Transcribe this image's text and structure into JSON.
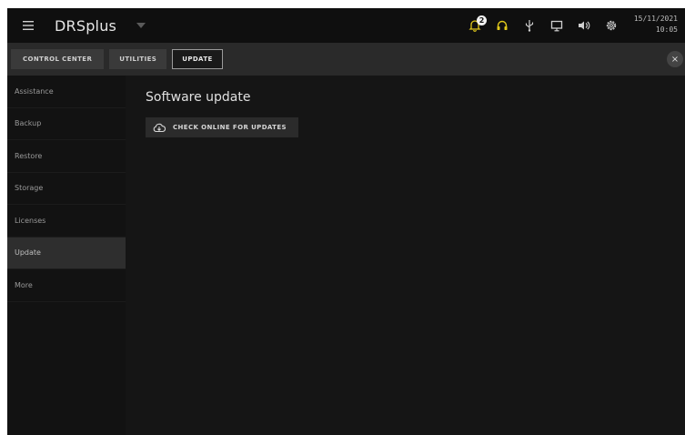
{
  "app": {
    "title": "DRSplus"
  },
  "status": {
    "notification_count": "2",
    "date": "15/11/2021",
    "time": "10:05",
    "colors": {
      "headset_accent": "#e0c81a"
    }
  },
  "icons": [
    "menu-icon",
    "caret-down-icon",
    "bell-icon",
    "headset-icon",
    "usb-icon",
    "monitor-icon",
    "volume-icon",
    "gear-icon",
    "cloud-download-icon",
    "close-icon"
  ],
  "tabs": [
    {
      "label": "CONTROL CENTER"
    },
    {
      "label": "UTILITIES"
    },
    {
      "label": "UPDATE"
    }
  ],
  "close_label": "×",
  "sidebar": {
    "items": [
      {
        "label": "Assistance"
      },
      {
        "label": "Backup"
      },
      {
        "label": "Restore"
      },
      {
        "label": "Storage"
      },
      {
        "label": "Licenses"
      },
      {
        "label": "Update"
      },
      {
        "label": "More"
      }
    ]
  },
  "main": {
    "title": "Software update",
    "action_label": "CHECK ONLINE FOR UPDATES"
  }
}
